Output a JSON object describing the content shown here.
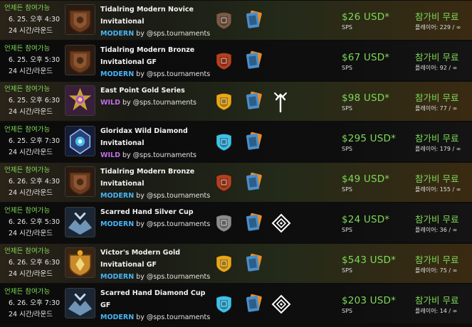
{
  "rows": [
    {
      "anytime": "언제든 참여가능",
      "date_time": "6. 25. 오후 4:30",
      "round": "24 시간/라운드",
      "name": "Tidalring Modern Novice Invitational",
      "format": "MODERN",
      "host": "by @sps.tournaments",
      "league_icon": "novice-league-icon",
      "prize": "$26 USD*",
      "currency": "SPS",
      "fee": "참가비 무료",
      "players": "플레이어: 229 / ∞",
      "theme": "light",
      "thumb": "bronze",
      "league": "novice",
      "ruleset": false
    },
    {
      "anytime": "언제든 참여가능",
      "date_time": "6. 25. 오후 5:30",
      "round": "24 시간/라운드",
      "name": "Tidalring Modern Bronze Invitational GF",
      "format": "MODERN",
      "host": "by @sps.tournaments",
      "league_icon": "bronze-league-icon",
      "prize": "$67 USD*",
      "currency": "SPS",
      "fee": "참가비 무료",
      "players": "플레이어: 92 / ∞",
      "theme": "dark",
      "thumb": "bronze",
      "league": "bronze",
      "ruleset": false
    },
    {
      "anytime": "언제든 참여가능",
      "date_time": "6. 25. 오후 6:30",
      "round": "24 시간/라운드",
      "name": "East Point Gold Series",
      "format": "WILD",
      "host": "by @sps.tournaments",
      "league_icon": "gold-league-icon",
      "prize": "$98 USD*",
      "currency": "SPS",
      "fee": "참가비 무료",
      "players": "플레이어: 77 / ∞",
      "theme": "light",
      "thumb": "eastpoint",
      "league": "gold",
      "ruleset": "arrow"
    },
    {
      "anytime": "언제든 참여가능",
      "date_time": "6. 25. 오후 7:30",
      "round": "24 시간/라운드",
      "name": "Gloridax Wild Diamond Invitational",
      "format": "WILD",
      "host": "by @sps.tournaments",
      "league_icon": "diamond-league-icon",
      "prize": "$295 USD*",
      "currency": "SPS",
      "fee": "참가비 무료",
      "players": "플레이어: 179 / ∞",
      "theme": "dark",
      "thumb": "gloridax",
      "league": "diamond",
      "ruleset": false
    },
    {
      "anytime": "언제든 참여가능",
      "date_time": "6. 26. 오후 4:30",
      "round": "24 시간/라운드",
      "name": "Tidalring Modern Bronze Invitational",
      "format": "MODERN",
      "host": "by @sps.tournaments",
      "league_icon": "bronze-league-icon",
      "prize": "$49 USD*",
      "currency": "SPS",
      "fee": "참가비 무료",
      "players": "플레이어: 155 / ∞",
      "theme": "light",
      "thumb": "bronze",
      "league": "bronze",
      "ruleset": false
    },
    {
      "anytime": "언제든 참여가능",
      "date_time": "6. 26. 오후 5:30",
      "round": "24 시간/라운드",
      "name": "Scarred Hand Silver Cup",
      "format": "MODERN",
      "host": "by @sps.tournaments",
      "league_icon": "silver-league-icon",
      "prize": "$24 USD*",
      "currency": "SPS",
      "fee": "참가비 무료",
      "players": "플레이어: 36 / ∞",
      "theme": "dark",
      "thumb": "scarred",
      "league": "silver",
      "ruleset": "diamond"
    },
    {
      "anytime": "언제든 참여가능",
      "date_time": "6. 26. 오후 6:30",
      "round": "24 시간/라운드",
      "name": "Victor's Modern Gold Invitational GF",
      "format": "MODERN",
      "host": "by @sps.tournaments",
      "league_icon": "gold-league-icon",
      "prize": "$543 USD*",
      "currency": "SPS",
      "fee": "참가비 무료",
      "players": "플레이어: 75 / ∞",
      "theme": "light",
      "thumb": "victor",
      "league": "gold",
      "ruleset": false
    },
    {
      "anytime": "언제든 참여가능",
      "date_time": "6. 26. 오후 7:30",
      "round": "24 시간/라운드",
      "name": "Scarred Hand Diamond Cup GF",
      "format": "MODERN",
      "host": "by @sps.tournaments",
      "league_icon": "diamond-league-icon",
      "prize": "$203 USD*",
      "currency": "SPS",
      "fee": "참가비 무료",
      "players": "플레이어: 14 / ∞",
      "theme": "dark",
      "thumb": "scarred",
      "league": "diamond",
      "ruleset": "diamond"
    }
  ],
  "colors": {
    "accent_green": "#7ed957",
    "modern_blue": "#48b4f5",
    "wild_purple": "#c26ee8",
    "bronze": "#b3401f",
    "silver": "#8c8c8c",
    "gold": "#e8a716",
    "diamond": "#3fc1e8",
    "novice": "#7a5a45"
  }
}
